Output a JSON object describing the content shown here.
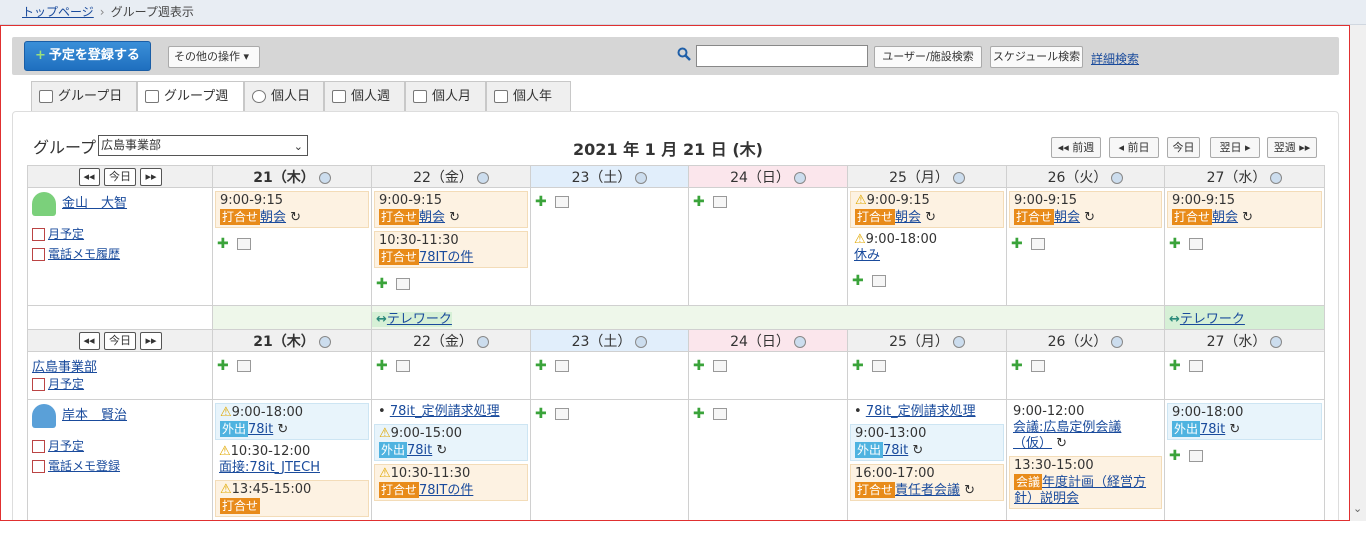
{
  "breadcrumb": {
    "home": "トップページ",
    "current": "グループ週表示"
  },
  "toolbar": {
    "add_label": "予定を登録する",
    "other_label": "その他の操作",
    "search_placeholder": "",
    "user_search": "ユーザー/施設検索",
    "schedule_search": "スケジュール検索",
    "advanced_search": "詳細検索"
  },
  "tabs": [
    "グループ日",
    "グループ週",
    "個人日",
    "個人週",
    "個人月",
    "個人年"
  ],
  "group": {
    "label": "グループ",
    "selected": "広島事業部"
  },
  "date_title": "2021 年 1 月 21 日 (木)",
  "nav": {
    "prev_week": "前週",
    "prev_day": "前日",
    "today": "今日",
    "next_day": "翌日",
    "next_week": "翌週"
  },
  "mini_nav": {
    "today": "今日"
  },
  "days": [
    "21（木）",
    "22（金）",
    "23（土）",
    "24（日）",
    "25（月）",
    "26（火）",
    "27（水）"
  ],
  "user1": {
    "name": "金山　大智",
    "monthly": "月予定",
    "memo": "電話メモ履歴",
    "events": {
      "d21_time": "9:00-9:15",
      "d21_tag": "打合せ",
      "d21_title": "朝会",
      "d22_time": "9:00-9:15",
      "d22_tag": "打合せ",
      "d22_title": "朝会",
      "d22b_time": "10:30-11:30",
      "d22b_tag": "打合せ",
      "d22b_title": "78ITの件",
      "d25_time": "9:00-9:15",
      "d25_tag": "打合せ",
      "d25_title": "朝会",
      "d25b_time": "9:00-18:00",
      "d25b_title": "休み",
      "d26_time": "9:00-9:15",
      "d26_tag": "打合せ",
      "d26_title": "朝会",
      "d27_time": "9:00-9:15",
      "d27_tag": "打合せ",
      "d27_title": "朝会"
    }
  },
  "telework": {
    "label1": "テレワーク",
    "label2": "テレワーク"
  },
  "dept": {
    "name": "広島事業部",
    "monthly": "月予定"
  },
  "user2": {
    "name": "岸本　賢治",
    "monthly": "月予定",
    "memo": "電話メモ登録",
    "events": {
      "d21_time": "9:00-18:00",
      "d21_tag": "外出",
      "d21_title": "78it",
      "d21b_time": "10:30-12:00",
      "d21b_title": "面接:78it_JTECH",
      "d21c_time": "13:45-15:00",
      "d21c_tag": "打合せ",
      "d22_note": "78it_定例請求処理",
      "d22_time": "9:00-15:00",
      "d22_tag": "外出",
      "d22_title": "78it",
      "d22b_time": "10:30-11:30",
      "d22b_tag": "打合せ",
      "d22b_title": "78ITの件",
      "d25_note": "78it_定例請求処理",
      "d25_time": "9:00-13:00",
      "d25_tag": "外出",
      "d25_title": "78it",
      "d25b_time": "16:00-17:00",
      "d25b_tag": "打合せ",
      "d25b_title": "責任者会議",
      "d26_time": "9:00-12:00",
      "d26_title": "会議:広島定例会議（仮）",
      "d26b_time": "13:30-15:00",
      "d26b_tag": "会議",
      "d26b_title": "年度計画（経営方針）説明会",
      "d27_time": "9:00-18:00",
      "d27_tag": "外出",
      "d27_title": "78it"
    }
  }
}
